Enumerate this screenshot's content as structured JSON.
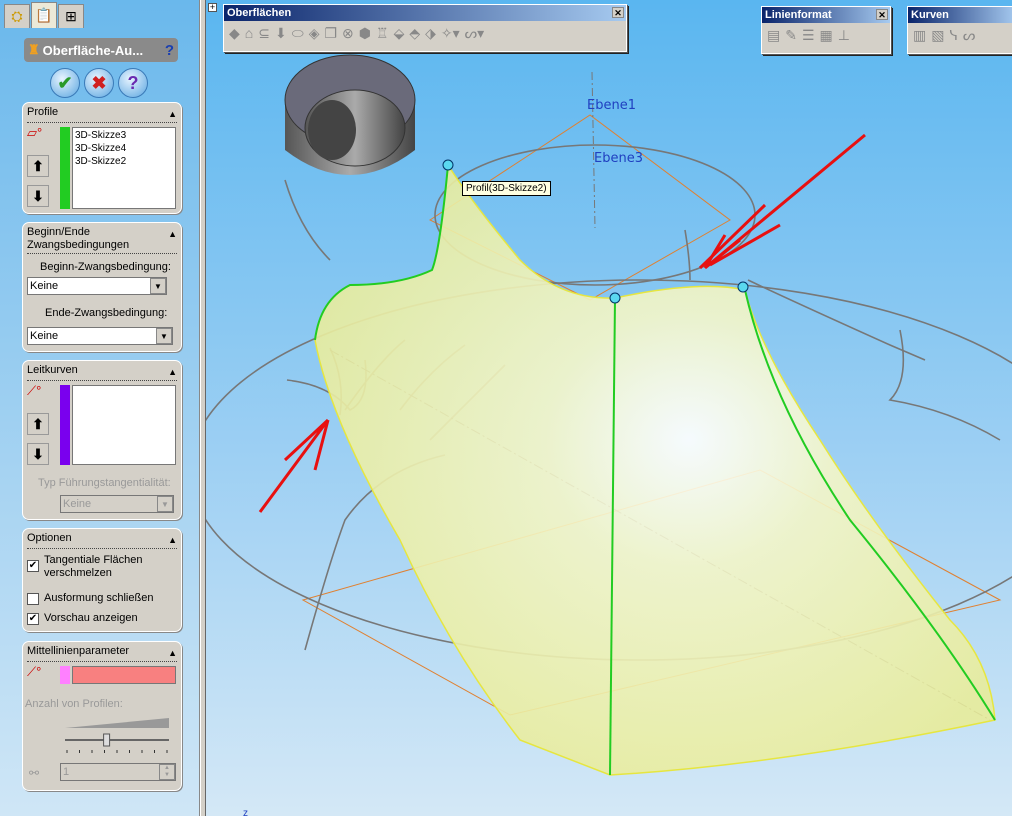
{
  "panel": {
    "tabs": [
      "feature-manager",
      "property-manager",
      "configuration-manager"
    ],
    "title": "Oberfläche-Au...",
    "buttons": {
      "ok": "✔",
      "cancel": "✖",
      "help": "?"
    },
    "profile": {
      "header": "Profile",
      "items": [
        "3D-Skizze3",
        "3D-Skizze4",
        "3D-Skizze2"
      ],
      "strip_color": "#22cc22"
    },
    "constraints": {
      "header_line1": "Beginn/Ende",
      "header_line2": "Zwangsbedingungen",
      "start_label": "Beginn-Zwangsbedingung:",
      "start_value": "Keine",
      "end_label": "Ende-Zwangsbedingung:",
      "end_value": "Keine"
    },
    "guides": {
      "header": "Leitkurven",
      "strip_color": "#7a00ee",
      "tangency_label": "Typ Führungstangentialität:",
      "tangency_value": "Keine"
    },
    "options": {
      "header": "Optionen",
      "merge_tangent_line1": "Tangentiale Flächen",
      "merge_tangent_line2": "verschmelzen",
      "merge_tangent_checked": true,
      "close_loft": "Ausformung schließen",
      "close_loft_checked": false,
      "show_preview": "Vorschau anzeigen",
      "show_preview_checked": true
    },
    "centerline": {
      "header": "Mittellinienparameter",
      "strip_color": "#ff80ff",
      "field_color": "#f88080",
      "count_label": "Anzahl von Profilen:",
      "count_value": "1",
      "slider_fraction": 0.4
    }
  },
  "toolbars": {
    "surfaces": {
      "title": "Oberflächen"
    },
    "line_format": {
      "title": "Linienformat"
    },
    "curves": {
      "title": "Kurven"
    }
  },
  "viewport": {
    "plane1": "Ebene1",
    "plane3": "Ebene3",
    "tooltip": "Profil(3D-Skizze2)",
    "triad_label": "z"
  }
}
